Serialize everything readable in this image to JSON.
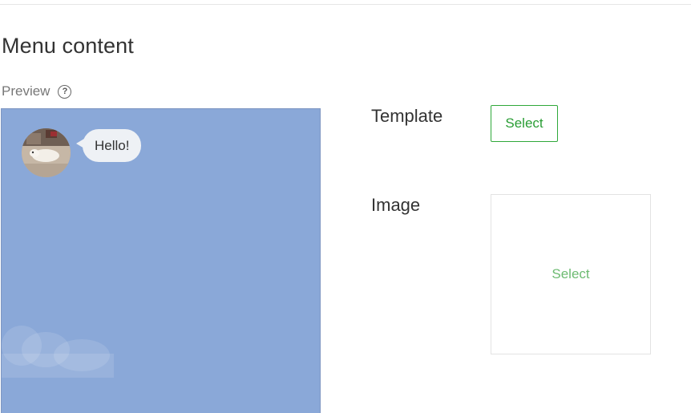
{
  "section": {
    "title": "Menu content"
  },
  "preview": {
    "label": "Preview",
    "help_icon": "help-circle-icon",
    "background_color": "#8aa8d8",
    "message": "Hello!",
    "avatar_icon": "profile-photo"
  },
  "template": {
    "label": "Template",
    "button_label": "Select",
    "accent_color": "#2a9d35"
  },
  "image": {
    "label": "Image",
    "select_label": "Select"
  }
}
